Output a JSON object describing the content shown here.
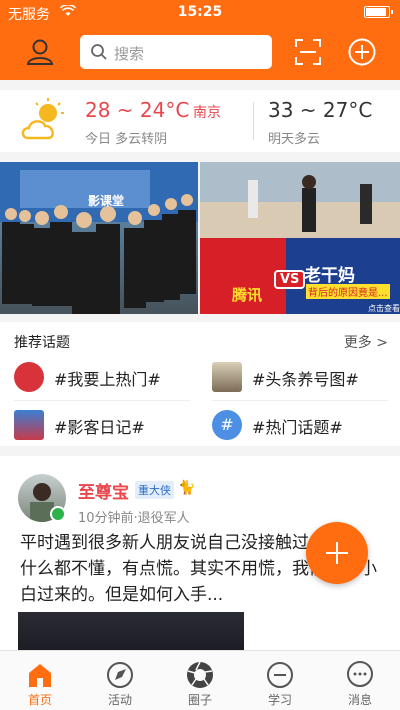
{
  "status_bar": {
    "carrier": "无服务",
    "time": "15:25"
  },
  "header": {
    "search_placeholder": "搜索"
  },
  "weather": {
    "today_temp": "28 ~ 24°C",
    "city": "南京",
    "today_desc": "今日 多云转阴",
    "tomorrow_temp": "33 ~ 27°C",
    "tomorrow_desc": "明天多云"
  },
  "banners": {
    "left_text": "影课堂",
    "right_tag1": "腾讯",
    "right_vs": "VS",
    "right_tag2": "老干妈",
    "right_sub": "背后的原因竟是...",
    "right_cta": "点击查看"
  },
  "topics": {
    "title": "推荐话题",
    "more": "更多 >",
    "items": [
      {
        "label": "#我要上热门#"
      },
      {
        "label": "#头条养号图#"
      },
      {
        "label": "#影客日记#"
      },
      {
        "label": "#热门话题#"
      }
    ]
  },
  "post": {
    "username": "至尊宝",
    "badge": "重大侠",
    "meta": "10分钟前·退役军人",
    "text": "平时遇到很多新人朋友说自己没接触过自媒体，什么都不懂，有点慌。其实不用慌，我们也是小白过来的。但是如何入手..."
  },
  "tabs": [
    {
      "label": "首页",
      "icon": "home-icon",
      "active": true
    },
    {
      "label": "活动",
      "icon": "activity-icon"
    },
    {
      "label": "圈子",
      "icon": "circle-icon"
    },
    {
      "label": "学习",
      "icon": "learn-icon"
    },
    {
      "label": "消息",
      "icon": "message-icon"
    }
  ],
  "colors": {
    "brand": "#ff6d10",
    "accent_red": "#e8474d"
  }
}
